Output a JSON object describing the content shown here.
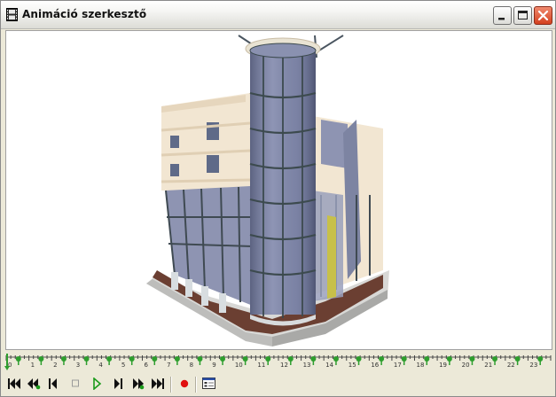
{
  "window": {
    "title": "Animáció szerkesztő",
    "controls": [
      "minimize",
      "maximize",
      "close"
    ]
  },
  "viewport": {
    "content": "3d-building-render"
  },
  "timeline": {
    "tick_labels": [
      "0",
      "1",
      "2",
      "3",
      "4",
      "5",
      "6",
      "7",
      "8",
      "9",
      "10",
      "11",
      "12",
      "13",
      "14",
      "15",
      "16",
      "17",
      "18",
      "19",
      "20",
      "21",
      "22",
      "23"
    ],
    "keyframe_count": 24,
    "keyframe_color": "#2e9e2e"
  },
  "toolbar": {
    "buttons": [
      {
        "name": "first-frame",
        "icon": "first-frame-icon"
      },
      {
        "name": "previous-keyframe",
        "icon": "previous-keyframe-icon"
      },
      {
        "name": "previous-frame",
        "icon": "previous-frame-icon"
      },
      {
        "name": "stop",
        "icon": "stop-icon"
      },
      {
        "name": "play",
        "icon": "play-icon"
      },
      {
        "name": "next-frame",
        "icon": "next-frame-icon"
      },
      {
        "name": "next-keyframe",
        "icon": "next-keyframe-icon"
      },
      {
        "name": "last-frame",
        "icon": "last-frame-icon"
      },
      {
        "name": "record",
        "icon": "record-icon"
      },
      {
        "name": "settings",
        "icon": "settings-icon"
      }
    ],
    "record_color": "#e01010",
    "play_color": "#1a9a1a"
  }
}
